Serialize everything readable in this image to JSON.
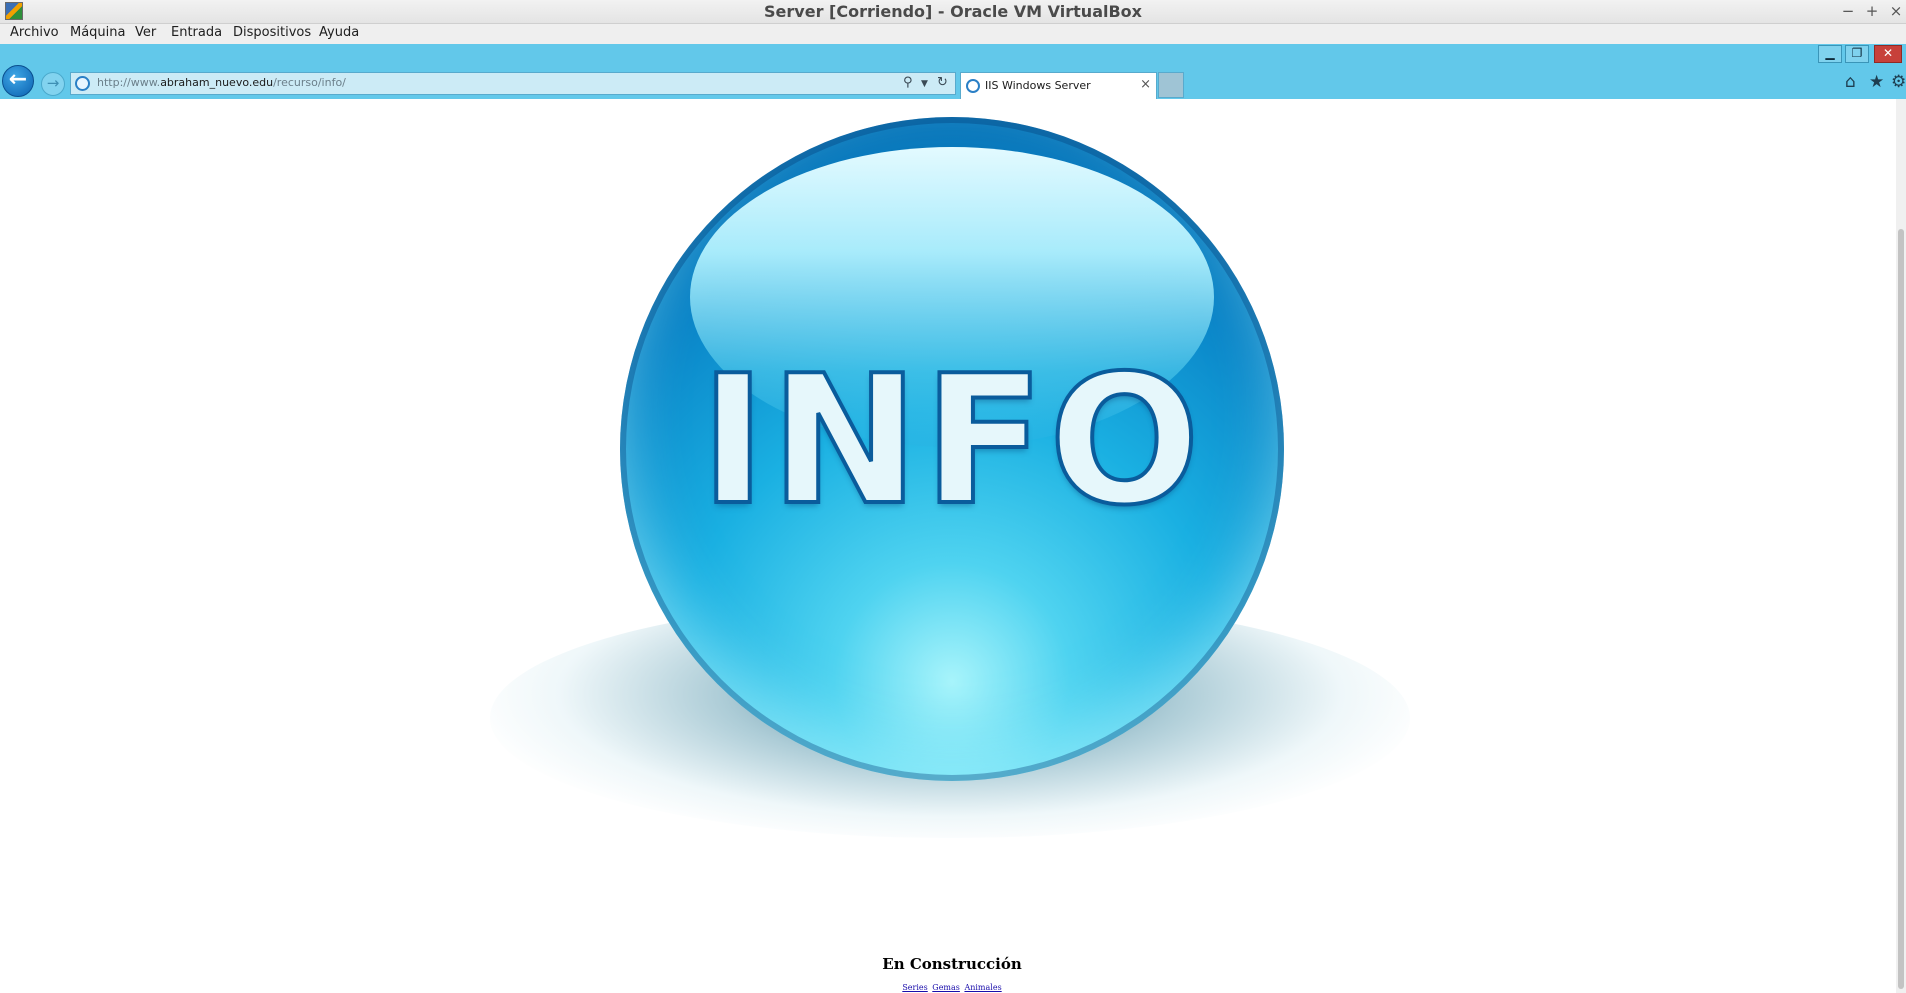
{
  "window": {
    "title": "Server [Corriendo] - Oracle VM VirtualBox",
    "controls": [
      "−",
      "+",
      "×"
    ]
  },
  "menu": {
    "items": [
      "Archivo",
      "Máquina",
      "Ver",
      "Entrada",
      "Dispositivos",
      "Ayuda"
    ]
  },
  "browser": {
    "address": {
      "prefix": "http://www.",
      "domain": "abraham_nuevo.edu",
      "path": "/recurso/info/"
    },
    "tab": {
      "title": "IIS Windows Server",
      "close": "×"
    },
    "window_controls": [
      "▁",
      "❐",
      "✕"
    ],
    "icons": {
      "back": "back-arrow-icon",
      "forward": "forward-arrow-icon",
      "search": "search-icon",
      "refresh": "refresh-icon",
      "home": "home-icon",
      "favorites": "star-icon",
      "tools": "gear-icon"
    }
  },
  "page": {
    "orb_text": "INFO",
    "heading": "En Construcción",
    "links": [
      "Series",
      "Gemas",
      "Animales"
    ]
  },
  "colors": {
    "ie_chrome": "#62c8ea",
    "orb_dark": "#0567ad",
    "orb_light": "#4fd3f0"
  }
}
